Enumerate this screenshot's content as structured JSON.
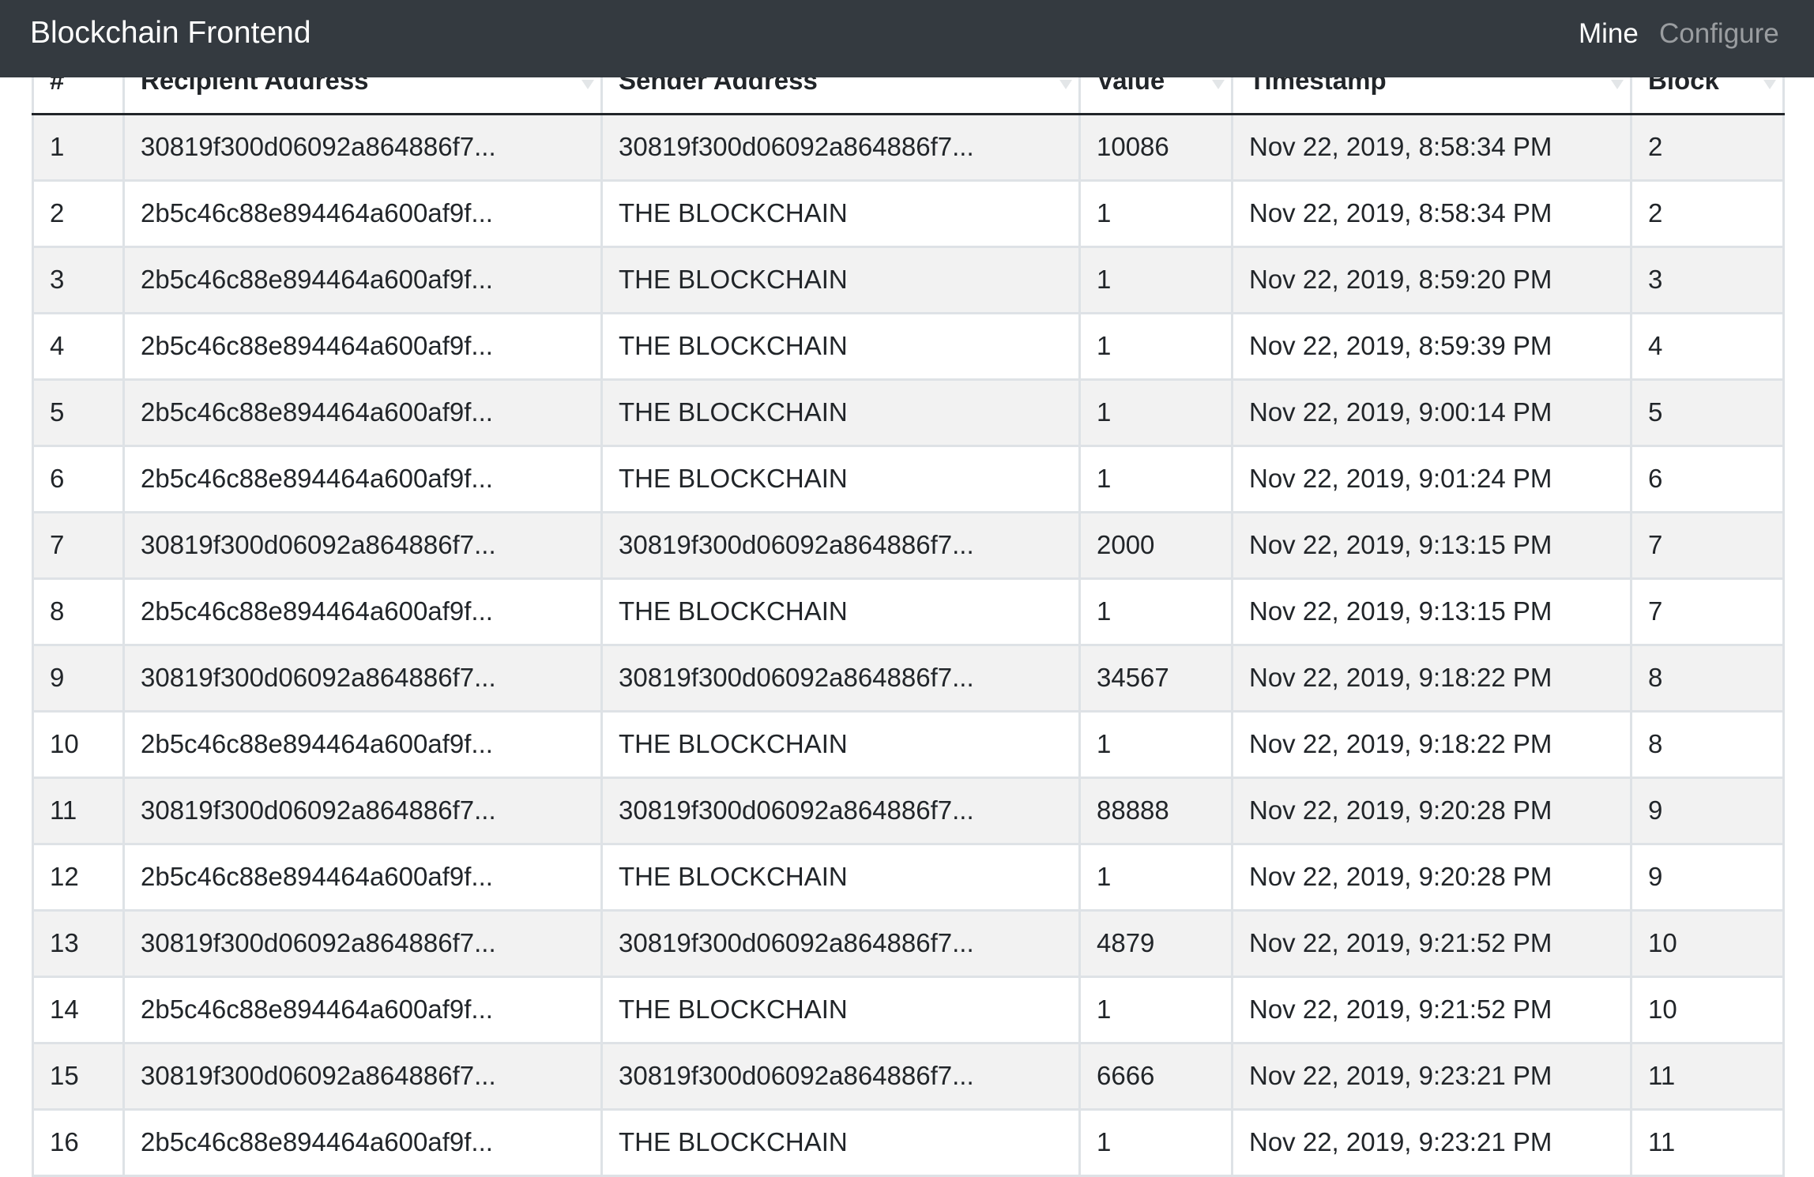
{
  "navbar": {
    "brand": "Blockchain Frontend",
    "mine_label": "Mine",
    "configure_label": "Configure"
  },
  "table": {
    "headers": [
      "#",
      "Recipient Address",
      "Sender Address",
      "Value",
      "Timestamp",
      "Block"
    ],
    "rows": [
      [
        "1",
        "30819f300d06092a864886f7...",
        "30819f300d06092a864886f7...",
        "10086",
        "Nov 22, 2019, 8:58:34 PM",
        "2"
      ],
      [
        "2",
        "2b5c46c88e894464a600af9f...",
        "THE BLOCKCHAIN",
        "1",
        "Nov 22, 2019, 8:58:34 PM",
        "2"
      ],
      [
        "3",
        "2b5c46c88e894464a600af9f...",
        "THE BLOCKCHAIN",
        "1",
        "Nov 22, 2019, 8:59:20 PM",
        "3"
      ],
      [
        "4",
        "2b5c46c88e894464a600af9f...",
        "THE BLOCKCHAIN",
        "1",
        "Nov 22, 2019, 8:59:39 PM",
        "4"
      ],
      [
        "5",
        "2b5c46c88e894464a600af9f...",
        "THE BLOCKCHAIN",
        "1",
        "Nov 22, 2019, 9:00:14 PM",
        "5"
      ],
      [
        "6",
        "2b5c46c88e894464a600af9f...",
        "THE BLOCKCHAIN",
        "1",
        "Nov 22, 2019, 9:01:24 PM",
        "6"
      ],
      [
        "7",
        "30819f300d06092a864886f7...",
        "30819f300d06092a864886f7...",
        "2000",
        "Nov 22, 2019, 9:13:15 PM",
        "7"
      ],
      [
        "8",
        "2b5c46c88e894464a600af9f...",
        "THE BLOCKCHAIN",
        "1",
        "Nov 22, 2019, 9:13:15 PM",
        "7"
      ],
      [
        "9",
        "30819f300d06092a864886f7...",
        "30819f300d06092a864886f7...",
        "34567",
        "Nov 22, 2019, 9:18:22 PM",
        "8"
      ],
      [
        "10",
        "2b5c46c88e894464a600af9f...",
        "THE BLOCKCHAIN",
        "1",
        "Nov 22, 2019, 9:18:22 PM",
        "8"
      ],
      [
        "11",
        "30819f300d06092a864886f7...",
        "30819f300d06092a864886f7...",
        "88888",
        "Nov 22, 2019, 9:20:28 PM",
        "9"
      ],
      [
        "12",
        "2b5c46c88e894464a600af9f...",
        "THE BLOCKCHAIN",
        "1",
        "Nov 22, 2019, 9:20:28 PM",
        "9"
      ],
      [
        "13",
        "30819f300d06092a864886f7...",
        "30819f300d06092a864886f7...",
        "4879",
        "Nov 22, 2019, 9:21:52 PM",
        "10"
      ],
      [
        "14",
        "2b5c46c88e894464a600af9f...",
        "THE BLOCKCHAIN",
        "1",
        "Nov 22, 2019, 9:21:52 PM",
        "10"
      ],
      [
        "15",
        "30819f300d06092a864886f7...",
        "30819f300d06092a864886f7...",
        "6666",
        "Nov 22, 2019, 9:23:21 PM",
        "11"
      ],
      [
        "16",
        "2b5c46c88e894464a600af9f...",
        "THE BLOCKCHAIN",
        "1",
        "Nov 22, 2019, 9:23:21 PM",
        "11"
      ]
    ]
  }
}
